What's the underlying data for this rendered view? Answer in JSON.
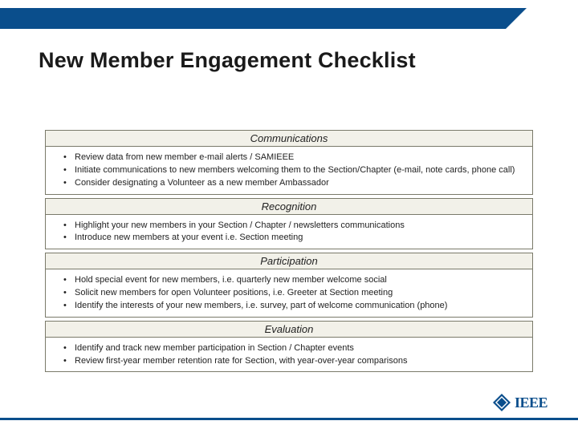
{
  "title": "New Member Engagement Checklist",
  "sections": [
    {
      "heading": "Communications",
      "items": [
        "Review data from new member e-mail alerts / SAMIEEE",
        "Initiate communications to new members welcoming them to the Section/Chapter (e-mail, note cards, phone call)",
        "Consider designating a Volunteer as a new member Ambassador"
      ]
    },
    {
      "heading": "Recognition",
      "items": [
        "Highlight your new members in your Section  /  Chapter  /   newsletters communications",
        "Introduce new members at your event i.e. Section meeting"
      ]
    },
    {
      "heading": "Participation",
      "items": [
        "Hold special event for new members, i.e. quarterly new member welcome social",
        "Solicit new members for open Volunteer positions, i.e. Greeter at Section meeting",
        "Identify the interests of your new members, i.e. survey, part of welcome communication (phone)"
      ]
    },
    {
      "heading": "Evaluation",
      "items": [
        "Identify and track new member participation in Section / Chapter events",
        "Review first-year member retention rate for Section, with year-over-year comparisons"
      ]
    }
  ],
  "logo_text": "IEEE"
}
